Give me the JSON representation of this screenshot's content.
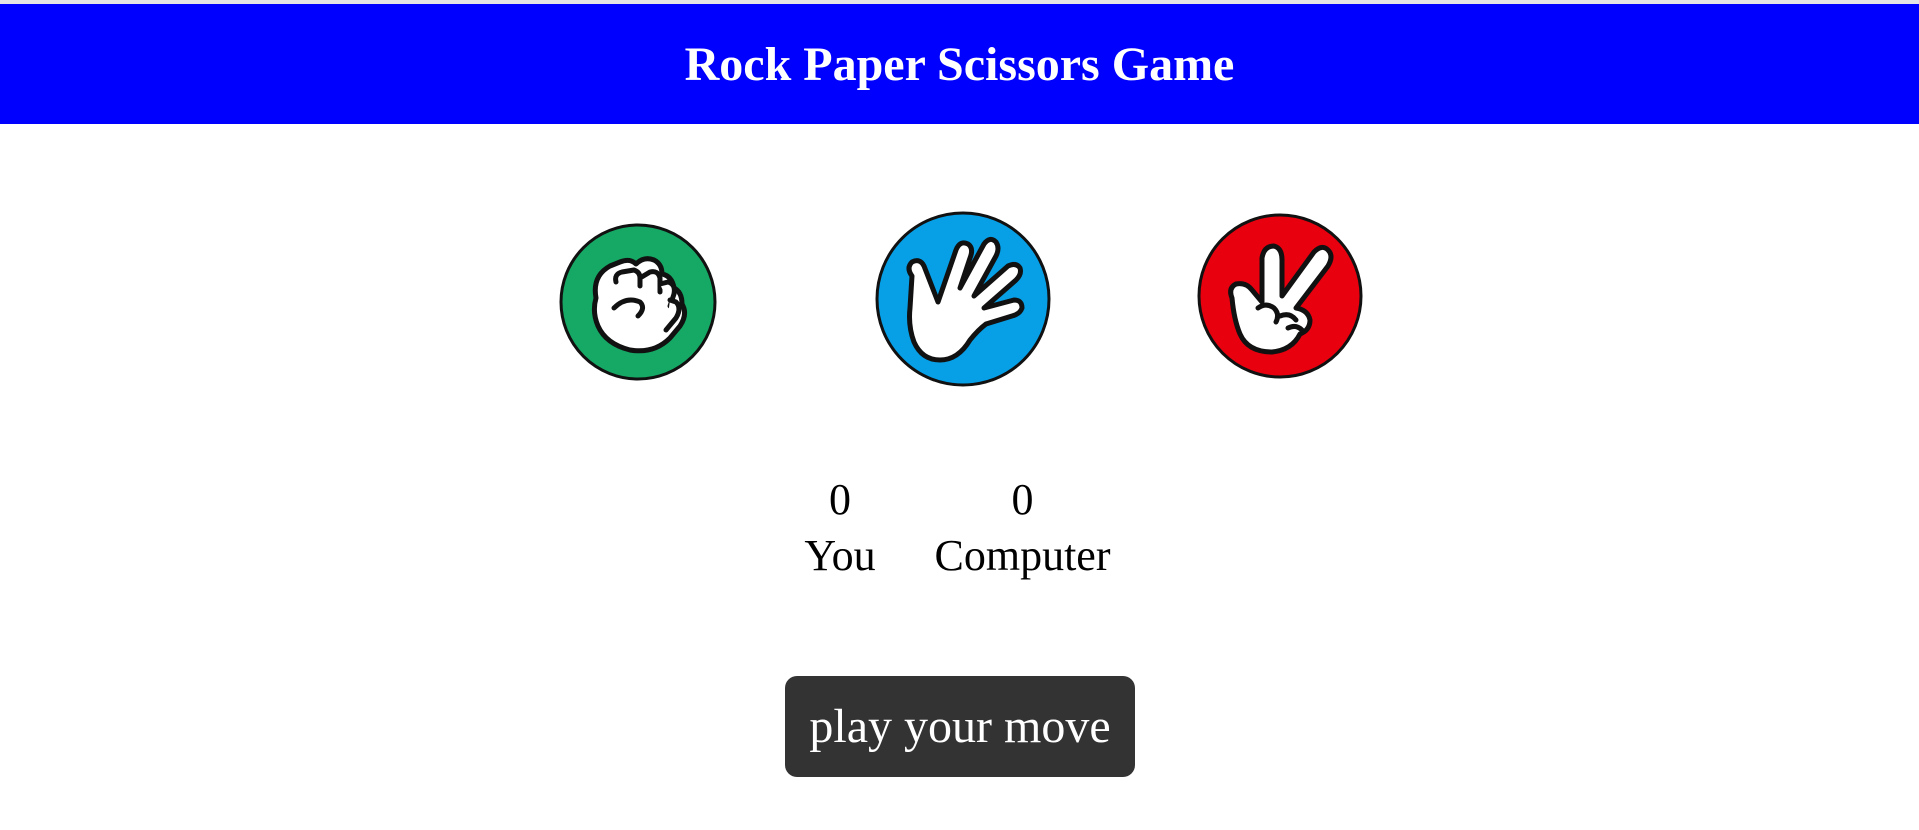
{
  "header": {
    "title": "Rock Paper Scissors Game",
    "background": "#0000ff"
  },
  "choices": [
    {
      "name": "rock",
      "icon": "rock-fist-icon",
      "color": "#16a865"
    },
    {
      "name": "paper",
      "icon": "paper-hand-icon",
      "color": "#079fe6"
    },
    {
      "name": "scissors",
      "icon": "scissors-hand-icon",
      "color": "#e8000f"
    }
  ],
  "scoreboard": {
    "user": {
      "score": "0",
      "label": "You"
    },
    "computer": {
      "score": "0",
      "label": "Computer"
    }
  },
  "message": {
    "text": "play your move",
    "background": "#333333"
  }
}
